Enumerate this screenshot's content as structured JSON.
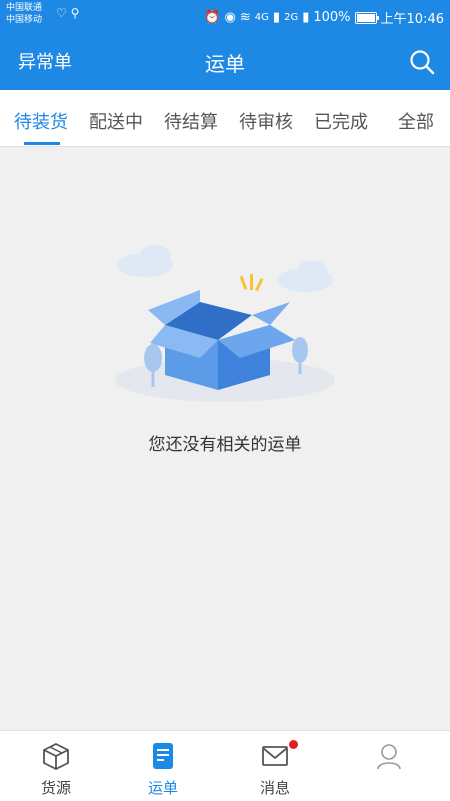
{
  "status_bar": {
    "carrier_1": "中国联通",
    "carrier_2": "中国移动",
    "network_1": "4G",
    "network_2": "2G",
    "battery": "100%",
    "time": "上午10:46"
  },
  "app_bar": {
    "left_label": "异常单",
    "title": "运单",
    "search_icon": "search-icon"
  },
  "tabs": [
    {
      "label": "待装货",
      "active": true
    },
    {
      "label": "配送中",
      "active": false
    },
    {
      "label": "待结算",
      "active": false
    },
    {
      "label": "待审核",
      "active": false
    },
    {
      "label": "已完成",
      "active": false
    },
    {
      "label": "全部",
      "active": false
    }
  ],
  "empty_state": {
    "message": "您还没有相关的运单",
    "illustration": "open-box-icon"
  },
  "bottom_nav": [
    {
      "label": "货源",
      "icon": "cube-icon",
      "active": false
    },
    {
      "label": "运单",
      "icon": "waybill-icon",
      "active": true
    },
    {
      "label": "消息",
      "icon": "mail-icon",
      "active": false,
      "badge": true
    },
    {
      "label": "",
      "icon": "user-icon",
      "active": false
    }
  ],
  "colors": {
    "primary": "#1e88e5",
    "background": "#f0f0f0",
    "badge": "#e02020"
  }
}
